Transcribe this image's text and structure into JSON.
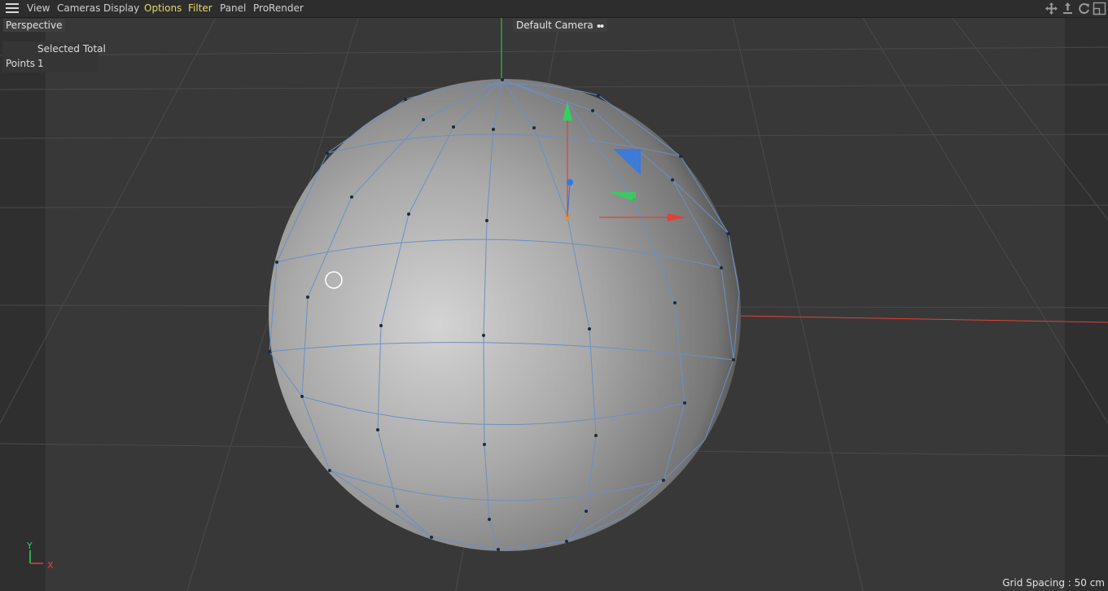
{
  "menu": {
    "items": [
      "View",
      "Cameras",
      "Display",
      "Options",
      "Filter",
      "Panel",
      "ProRender"
    ]
  },
  "nav_icons": [
    "move-view-icon",
    "dolly-view-icon",
    "rotate-view-icon",
    "toggle-layout-icon"
  ],
  "viewport": {
    "view_name": "Perspective",
    "camera": "Default Camera",
    "hud": {
      "column_header": "Selected Total",
      "row_label": "Points",
      "row_value": "1"
    },
    "axis_labels": {
      "y": "Y",
      "x": "X"
    },
    "grid_spacing": "Grid Spacing : 50 cm"
  },
  "colors": {
    "menu_active": "#e8d96a",
    "wire": "#6d8fc4",
    "x_axis": "#e0413a",
    "y_axis": "#2fd35b",
    "z_axis": "#3279e6",
    "selected_point": "#e8902c"
  }
}
